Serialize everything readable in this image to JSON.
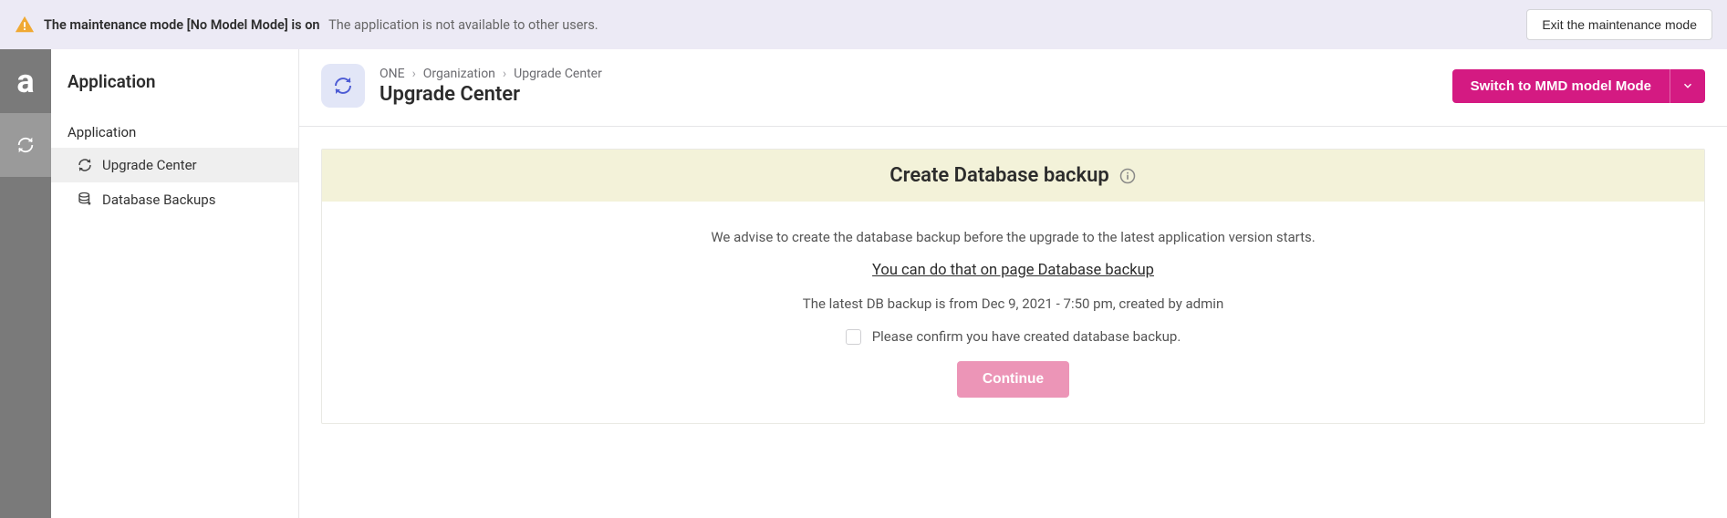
{
  "maintenance": {
    "title": "The maintenance mode [No Model Mode] is on",
    "subtitle": "The application is not available to other users.",
    "exit_label": "Exit the maintenance mode"
  },
  "sidebar": {
    "title": "Application",
    "section_label": "Application",
    "items": [
      {
        "label": "Upgrade Center",
        "icon": "refresh-icon",
        "active": true
      },
      {
        "label": "Database Backups",
        "icon": "database-icon",
        "active": false
      }
    ]
  },
  "header": {
    "breadcrumbs": [
      "ONE",
      "Organization",
      "Upgrade Center"
    ],
    "page_title": "Upgrade Center",
    "mode_button_label": "Switch to MMD model Mode"
  },
  "card": {
    "title": "Create Database backup",
    "advice": "We advise to create the database backup before the upgrade to the latest application version starts.",
    "link_text": "You can do that on page Database backup",
    "latest_backup": "The latest DB backup is from Dec 9, 2021 - 7:50 pm, created by admin",
    "confirm_label": "Please confirm you have created database backup.",
    "continue_label": "Continue"
  }
}
